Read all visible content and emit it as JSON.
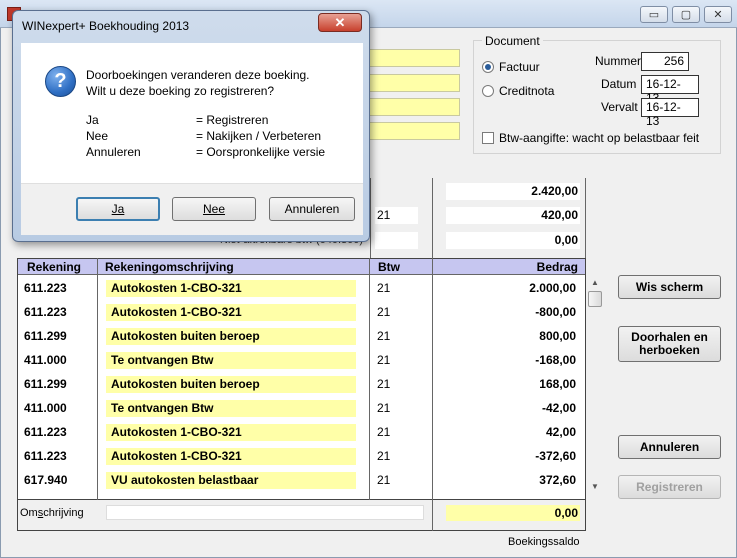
{
  "main_window": {
    "caption_buttons": {
      "minimize": "▭",
      "maximize": "▢",
      "close": "✕"
    }
  },
  "document": {
    "legend": "Document",
    "radio_factuur": "Factuur",
    "radio_creditnota": "Creditnota",
    "selected": "Factuur",
    "nummer_label": "Nummer",
    "nummer_value": "256",
    "datum_label": "Datum",
    "datum_value": "16-12-13",
    "vervalt_label": "Vervalt",
    "vervalt_value": "16-12-13",
    "btw_checkbox_label": "Btw-aangifte: wacht op belastbaar feit"
  },
  "totals": {
    "total_value": "2.420,00",
    "btw_code": "21",
    "btw_value": "420,00",
    "niet_aftrekbaar_label": "Niet-aftrekbare btw  (640.300)",
    "niet_aftrekbaar_value": "0,00"
  },
  "table": {
    "headers": [
      "Rekening",
      "Rekeningomschrijving",
      "Btw",
      "Bedrag"
    ],
    "rows": [
      {
        "rekening": "611.223",
        "omschrijving": "Autokosten 1-CBO-321",
        "btw": "21",
        "bedrag": "2.000,00"
      },
      {
        "rekening": "611.223",
        "omschrijving": "Autokosten 1-CBO-321",
        "btw": "21",
        "bedrag": "-800,00"
      },
      {
        "rekening": "611.299",
        "omschrijving": "Autokosten buiten beroep",
        "btw": "21",
        "bedrag": "800,00"
      },
      {
        "rekening": "411.000",
        "omschrijving": "Te ontvangen Btw",
        "btw": "21",
        "bedrag": "-168,00"
      },
      {
        "rekening": "611.299",
        "omschrijving": "Autokosten buiten beroep",
        "btw": "21",
        "bedrag": "168,00"
      },
      {
        "rekening": "411.000",
        "omschrijving": "Te ontvangen Btw",
        "btw": "21",
        "bedrag": "-42,00"
      },
      {
        "rekening": "611.223",
        "omschrijving": "Autokosten 1-CBO-321",
        "btw": "21",
        "bedrag": "42,00"
      },
      {
        "rekening": "611.223",
        "omschrijving": "Autokosten 1-CBO-321",
        "btw": "21",
        "bedrag": "-372,60"
      },
      {
        "rekening": "617.940",
        "omschrijving": "VU autokosten belastbaar",
        "btw": "21",
        "bedrag": "372,60"
      }
    ]
  },
  "footer": {
    "omschrijving_label": "Omschrijving",
    "omschrijving_value": "",
    "saldo_value": "0,00",
    "saldo_label": "Boekingssaldo"
  },
  "buttons": {
    "wis_scherm": "Wis scherm",
    "doorhalen": "Doorhalen en herboeken",
    "annuleren": "Annuleren",
    "registreren": "Registreren"
  },
  "dialog": {
    "title": "WINexpert+ Boekhouding 2013",
    "close": "✕",
    "icon": "?",
    "message_line1": "Doorboekingen veranderen deze boeking.",
    "message_line2": "Wilt u deze boeking zo registreren?",
    "options": [
      {
        "key": "Ja",
        "desc": "= Registreren"
      },
      {
        "key": "Nee",
        "desc": "= Nakijken / Verbeteren"
      },
      {
        "key": "Annuleren",
        "desc": "= Oorspronkelijke versie"
      }
    ],
    "btn_ja": "Ja",
    "btn_nee": "Nee",
    "btn_annuleren": "Annuleren"
  },
  "colors": {
    "field_yellow": "#ffffa8",
    "header_blue": "#c6c6f0",
    "dialog_icon_blue": "#2f6fc4"
  }
}
